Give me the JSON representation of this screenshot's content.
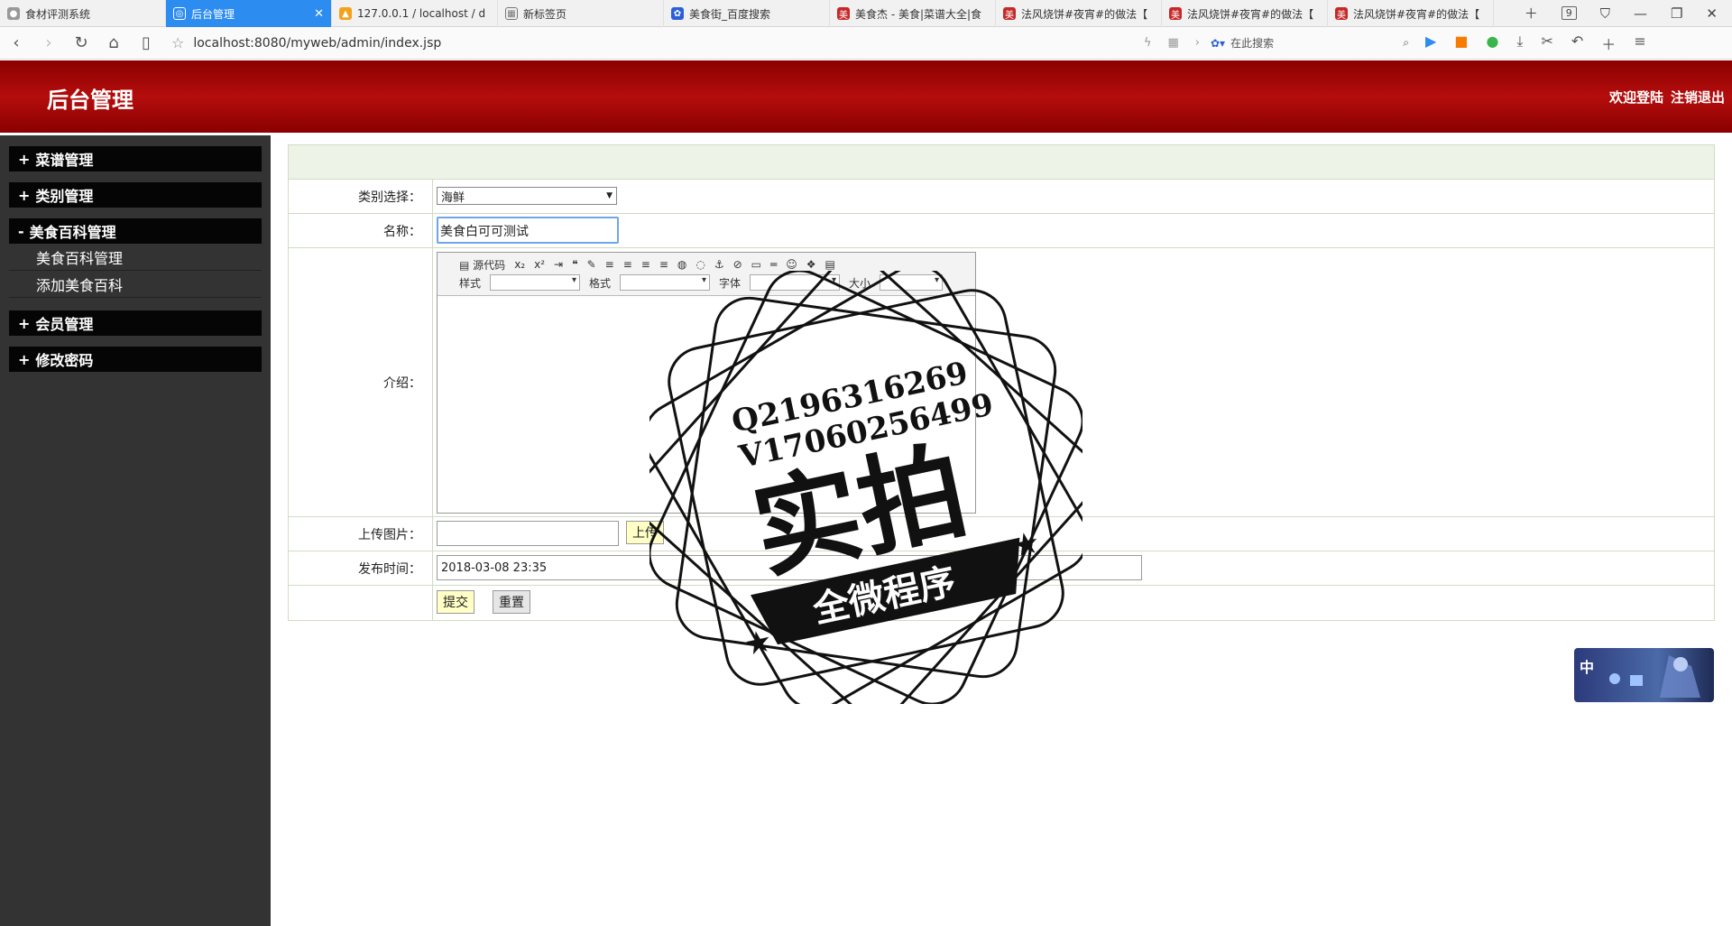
{
  "browser": {
    "tabs": [
      {
        "title": "食材评测系统",
        "active": false
      },
      {
        "title": "后台管理",
        "active": true
      },
      {
        "title": "127.0.0.1 / localhost / d",
        "active": false
      },
      {
        "title": "新标签页",
        "active": false
      },
      {
        "title": "美食街_百度搜索",
        "active": false
      },
      {
        "title": "美食杰 - 美食|菜谱大全|食",
        "active": false
      },
      {
        "title": "法风烧饼#夜宵#的做法【",
        "active": false
      },
      {
        "title": "法风烧饼#夜宵#的做法【",
        "active": false
      },
      {
        "title": "法风烧饼#夜宵#的做法【",
        "active": false
      }
    ],
    "tab_count": "9",
    "url": "localhost:8080/myweb/admin/index.jsp",
    "search_placeholder": "在此搜索"
  },
  "header": {
    "title": "后台管理",
    "welcome": "欢迎登陆",
    "logout": "注销退出"
  },
  "sidebar": {
    "groups": [
      {
        "label": "菜谱管理",
        "sign": "+"
      },
      {
        "label": "类别管理",
        "sign": "+"
      },
      {
        "label": "美食百科管理",
        "sign": "-",
        "items": [
          "美食百科管理",
          "添加美食百科"
        ]
      },
      {
        "label": "会员管理",
        "sign": "+"
      },
      {
        "label": "修改密码",
        "sign": "+"
      }
    ]
  },
  "form": {
    "category_label": "类别选择：",
    "category_value": "海鲜",
    "name_label": "名称：",
    "name_value": "美食白可可测试",
    "intro_label": "介绍：",
    "editor": {
      "source_button": "源代码",
      "style_label": "样式",
      "format_label": "格式",
      "font_label": "字体",
      "size_label": "大小"
    },
    "upload_label": "上传图片：",
    "upload_button": "上传",
    "date_label": "发布时间：",
    "date_value": "2018-03-08 23:35",
    "submit_button": "提交",
    "reset_button": "重置"
  },
  "watermark": {
    "qq": "Q2196316269",
    "vx": "V17060256499",
    "main": "实拍",
    "banner": "全微程序"
  },
  "ime": {
    "label": "中"
  }
}
